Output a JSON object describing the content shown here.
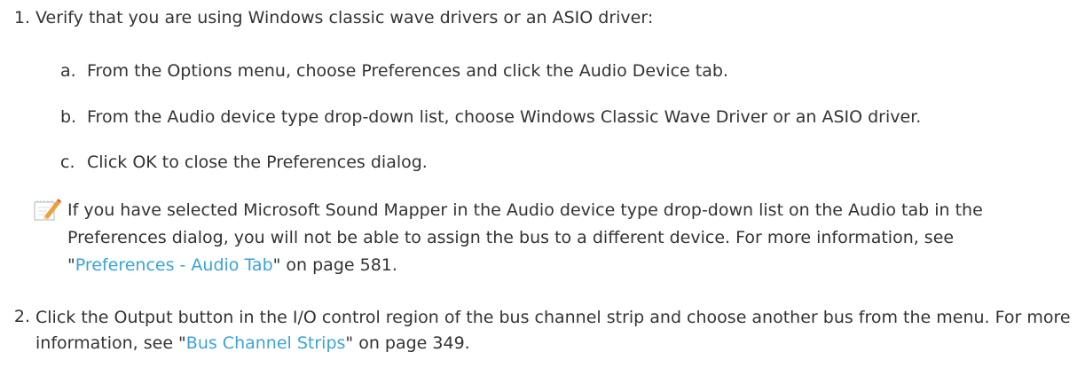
{
  "steps": [
    {
      "number": "1.",
      "text": "Verify that you are using Windows classic wave drivers or an ASIO driver:",
      "substeps": [
        {
          "letter": "a.",
          "text": "From the Options menu, choose Preferences and click the Audio Device tab."
        },
        {
          "letter": "b.",
          "text": "From the Audio device type drop-down list, choose Windows Classic Wave Driver or an ASIO driver."
        },
        {
          "letter": "c.",
          "text": "Click OK to close the Preferences dialog."
        }
      ]
    },
    {
      "number": "2.",
      "text_before": "Click the Output button in the I/O control region of the bus channel strip and choose another bus from the menu. For more information, see \"",
      "link": "Bus Channel Strips",
      "text_after": "\" on page 349."
    }
  ],
  "note": {
    "icon": "note-pencil-icon",
    "text_before": "If you have selected Microsoft Sound Mapper in the Audio device type drop-down list on the Audio tab in the Preferences dialog, you will not be able to assign the bus to a different device. For more information, see \"",
    "link": "Preferences - Audio Tab",
    "text_after": "\" on page 581."
  },
  "colors": {
    "text": "#333333",
    "link": "#3aa3d8"
  }
}
